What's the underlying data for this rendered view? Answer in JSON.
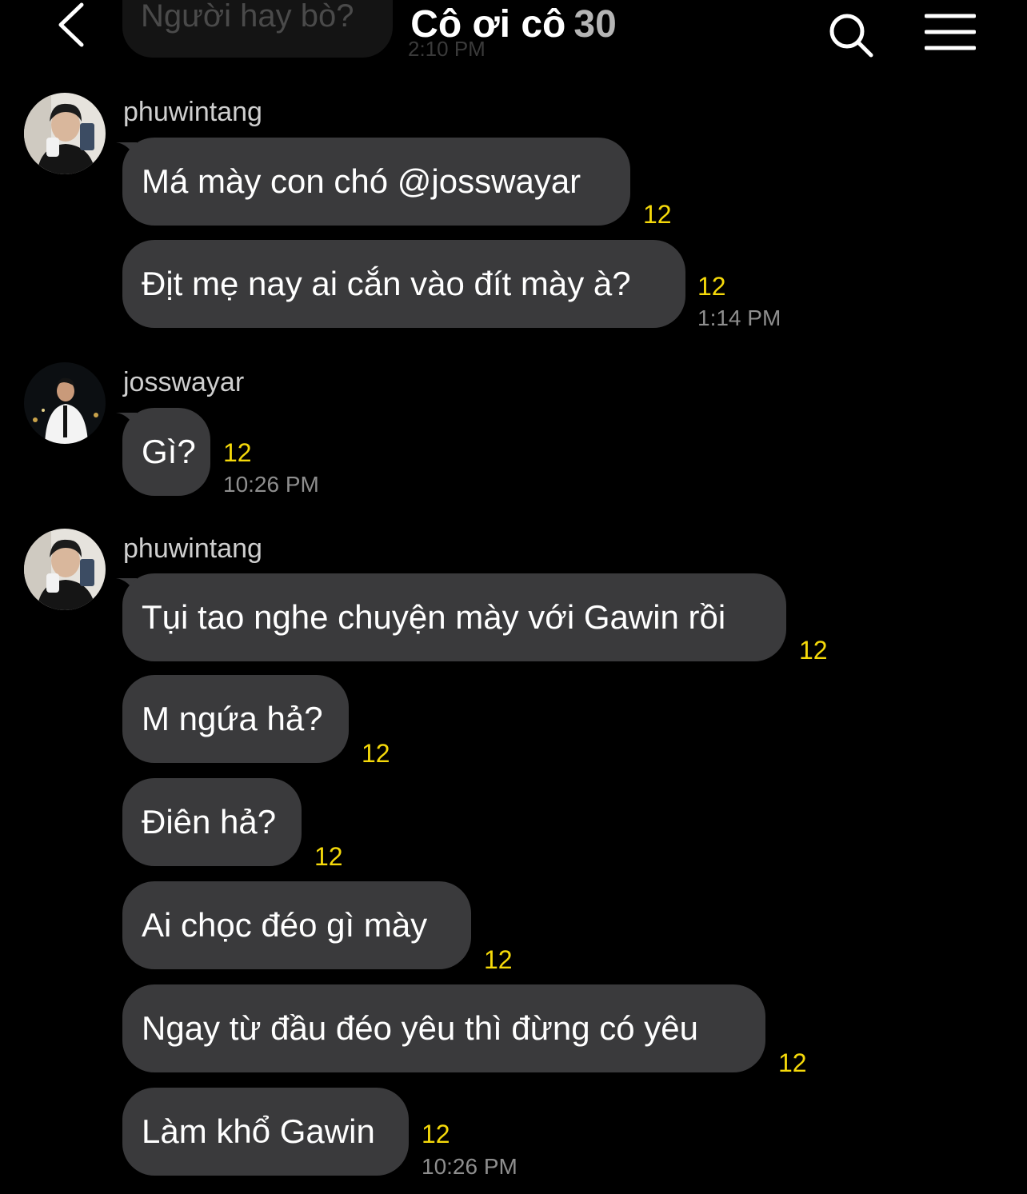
{
  "header": {
    "title": "Cô ơi cô",
    "count": "30"
  },
  "previous_message": {
    "text": "Người hay bò?",
    "time": "2:10 PM"
  },
  "groups": [
    {
      "sender": "phuwintang",
      "messages": [
        {
          "text": "Má mày con chó @josswayar",
          "count": "12"
        },
        {
          "text": "Địt mẹ nay ai cắn vào đít mày à?",
          "count": "12",
          "time": "1:14 PM"
        }
      ]
    },
    {
      "sender": "josswayar",
      "messages": [
        {
          "text": "Gì?",
          "count": "12",
          "time": "10:26 PM"
        }
      ]
    },
    {
      "sender": "phuwintang",
      "messages": [
        {
          "text": "Tụi tao nghe chuyện mày với Gawin rồi",
          "count": "12"
        },
        {
          "text": "M ngứa hả?",
          "count": "12"
        },
        {
          "text": "Điên hả?",
          "count": "12"
        },
        {
          "text": "Ai chọc đéo gì mày",
          "count": "12"
        },
        {
          "text": "Ngay từ đầu đéo yêu thì đừng có yêu",
          "count": "12"
        },
        {
          "text": "Làm khổ Gawin",
          "count": "12",
          "time": "10:26 PM"
        }
      ]
    }
  ],
  "colors": {
    "background": "#000000",
    "bubble": "#3a3a3c",
    "count": "#f5d90a",
    "timestamp": "#8e8e8e"
  }
}
